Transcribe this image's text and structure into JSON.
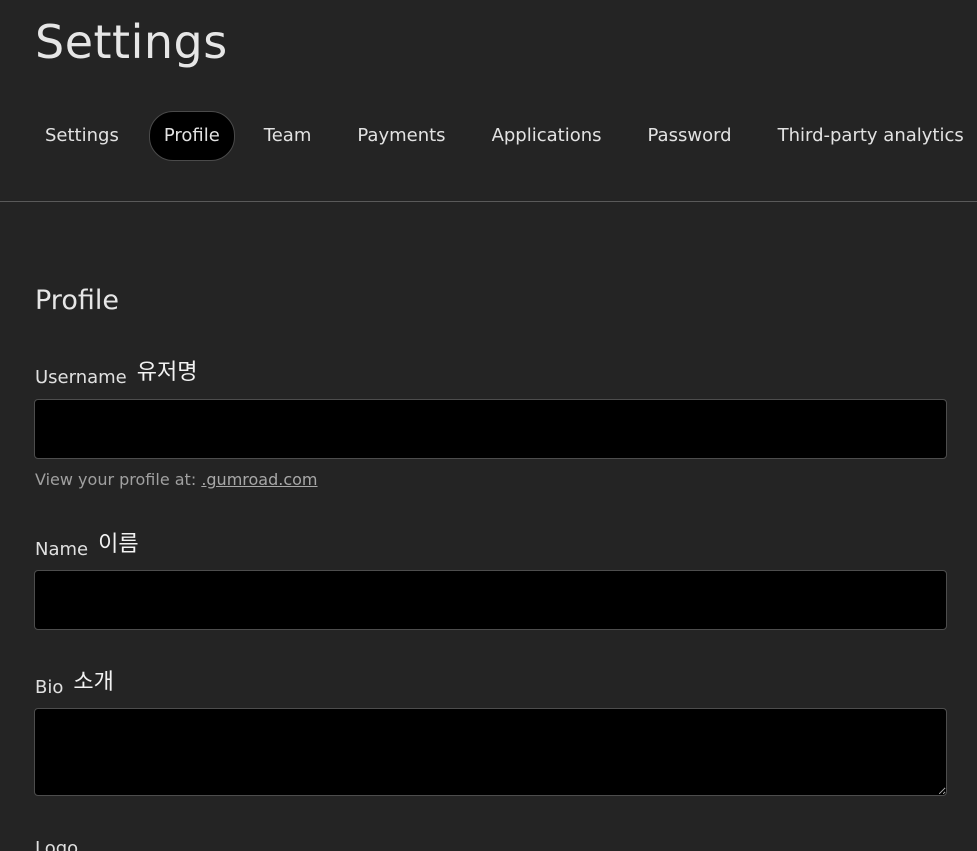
{
  "header": {
    "title": "Settings"
  },
  "tabs": [
    {
      "label": "Settings",
      "active": false
    },
    {
      "label": "Profile",
      "active": true
    },
    {
      "label": "Team",
      "active": false
    },
    {
      "label": "Payments",
      "active": false
    },
    {
      "label": "Applications",
      "active": false
    },
    {
      "label": "Password",
      "active": false
    },
    {
      "label": "Third-party analytics",
      "active": false
    }
  ],
  "profile": {
    "section_title": "Profile",
    "username": {
      "label": "Username",
      "annotation": "유저명",
      "value": ""
    },
    "profile_hint": {
      "prefix": "View your profile at:",
      "link_text": ".gumroad.com"
    },
    "name": {
      "label": "Name",
      "annotation": "이름",
      "value": ""
    },
    "bio": {
      "label": "Bio",
      "annotation": "소개",
      "value": ""
    },
    "logo": {
      "label": "Logo"
    }
  },
  "colors": {
    "background": "#242424",
    "input_background": "#000000",
    "active_tab_background": "#000000",
    "text": "#e4e4e4",
    "muted_text": "#a0a0a0"
  }
}
